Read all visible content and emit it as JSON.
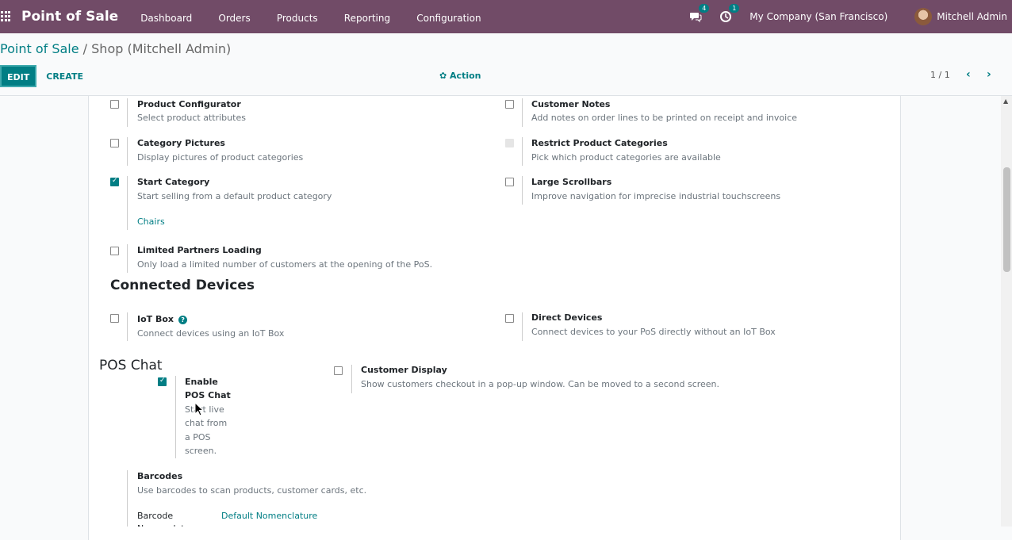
{
  "topbar": {
    "app_name": "Point of Sale",
    "menu": [
      "Dashboard",
      "Orders",
      "Products",
      "Reporting",
      "Configuration"
    ],
    "messages_count": "4",
    "activities_count": "1",
    "company": "My Company (San Francisco)",
    "user": "Mitchell Admin"
  },
  "breadcrumb": {
    "parent": "Point of Sale",
    "separator": " / ",
    "current": "Shop (Mitchell Admin)"
  },
  "buttons": {
    "edit": "EDIT",
    "create": "CREATE",
    "action": "Action"
  },
  "pager": {
    "value": "1 / 1"
  },
  "settings": {
    "product_configurator": {
      "title": "Product Configurator",
      "desc": "Select product attributes",
      "checked": false
    },
    "customer_notes": {
      "title": "Customer Notes",
      "desc": "Add notes on order lines to be printed on receipt and invoice",
      "checked": false
    },
    "category_pictures": {
      "title": "Category Pictures",
      "desc": "Display pictures of product categories",
      "checked": false
    },
    "restrict_categories": {
      "title": "Restrict Product Categories",
      "desc": "Pick which product categories are available",
      "checked": false
    },
    "start_category": {
      "title": "Start Category",
      "desc": "Start selling from a default product category",
      "checked": true,
      "value": "Chairs"
    },
    "large_scrollbars": {
      "title": "Large Scrollbars",
      "desc": "Improve navigation for imprecise industrial touchscreens",
      "checked": false
    },
    "limited_partners": {
      "title": "Limited Partners Loading",
      "desc": "Only load a limited number of customers at the opening of the PoS.",
      "checked": false
    }
  },
  "connected_devices": {
    "heading": "Connected Devices",
    "iot_box": {
      "title": "IoT Box",
      "desc": "Connect devices using an IoT Box",
      "checked": false
    },
    "direct_devices": {
      "title": "Direct Devices",
      "desc": "Connect devices to your PoS directly without an IoT Box",
      "checked": false
    }
  },
  "pos_chat": {
    "heading": "POS Chat",
    "enable": {
      "line1": "Enable",
      "line2": "POS Chat",
      "desc_lines": [
        "Start live",
        "chat from",
        "a POS",
        "screen."
      ],
      "checked": true
    },
    "customer_display": {
      "title": "Customer Display",
      "desc": "Show customers checkout in a pop-up window. Can be moved to a second screen.",
      "checked": false
    }
  },
  "barcodes": {
    "title": "Barcodes",
    "desc": "Use barcodes to scan products, customer cards, etc.",
    "field_label": "Barcode",
    "field_label2": "Nomenclature",
    "field_value": "Default Nomenclature"
  },
  "colors": {
    "brand": "#714b67",
    "accent": "#017e84"
  }
}
